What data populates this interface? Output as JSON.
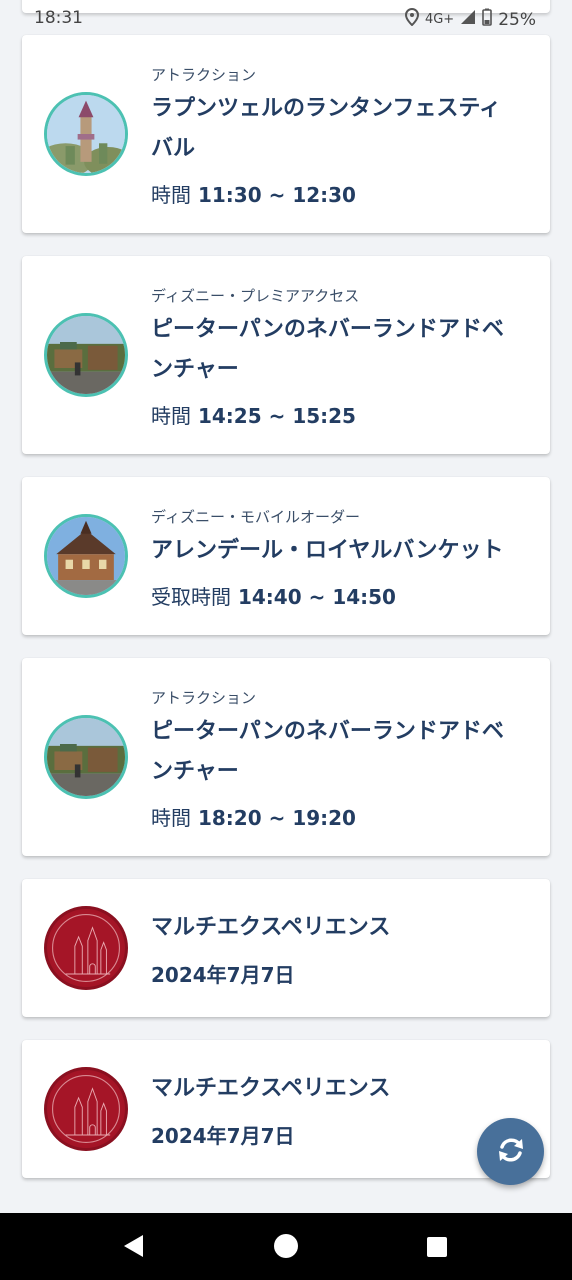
{
  "status_bar": {
    "time": "18:31",
    "network": "4G+",
    "battery": "25%"
  },
  "cards": [
    {
      "category": "アトラクション",
      "title_line1": "ラプンツェルのランタンフェスティ",
      "title_line2": "バル",
      "time_label": "時間",
      "time_range": "11:30 ~ 12:30",
      "thumb": "rapunzel-tower"
    },
    {
      "category": "ディズニー・プレミアアクセス",
      "title_line1": "ピーターパンのネバーランドアドベ",
      "title_line2": "ンチャー",
      "time_label": "時間",
      "time_range": "14:25 ~ 15:25",
      "thumb": "peter-pan-ride"
    },
    {
      "category": "ディズニー・モバイルオーダー",
      "title_line1": "アレンデール・ロイヤルバンケット",
      "time_label": "受取時間",
      "time_range": "14:40 ~ 14:50",
      "thumb": "arendelle-hall"
    },
    {
      "category": "アトラクション",
      "title_line1": "ピーターパンのネバーランドアドベ",
      "title_line2": "ンチャー",
      "time_label": "時間",
      "time_range": "18:20 ~ 19:20",
      "thumb": "peter-pan-ride"
    },
    {
      "title_line1": "マルチエクスペリエンス",
      "date": "2024年7月7日",
      "thumb": "castle-red"
    },
    {
      "title_line1": "マルチエクスペリエンス",
      "date": "2024年7月7日",
      "thumb": "castle-red"
    }
  ],
  "fab": {
    "icon": "refresh-icon"
  },
  "nav": {
    "back": "back-icon",
    "home": "home-icon",
    "recents": "recents-icon"
  }
}
